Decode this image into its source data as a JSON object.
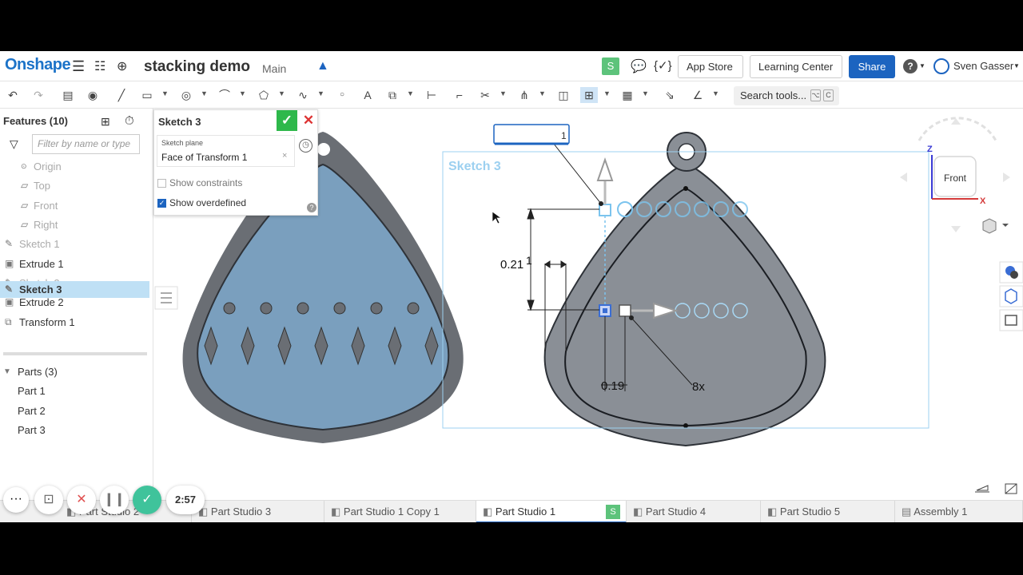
{
  "header": {
    "logo": "Onshape",
    "doc_title": "stacking demo",
    "branch": "Main",
    "badge": "S",
    "code_icon_text": "{✓}",
    "app_store": "App Store",
    "learning_center": "Learning Center",
    "share": "Share",
    "help": "?",
    "user": "Sven Gasser"
  },
  "toolbar": {
    "search_tools": "Search tools...",
    "kbd1": "⌥",
    "kbd2": "C"
  },
  "features": {
    "title": "Features (10)",
    "filter_placeholder": "Filter by name or type",
    "items": [
      {
        "label": "Origin",
        "icon": "origin-icon"
      },
      {
        "label": "Top",
        "icon": "plane-icon"
      },
      {
        "label": "Front",
        "icon": "plane-icon"
      },
      {
        "label": "Right",
        "icon": "plane-icon"
      },
      {
        "label": "Sketch 1",
        "icon": "sketch-icon"
      },
      {
        "label": "Extrude 1",
        "icon": "extrude-icon"
      },
      {
        "label": "Sketch 2",
        "icon": "sketch-icon"
      },
      {
        "label": "Extrude 2",
        "icon": "extrude-icon"
      },
      {
        "label": "Transform 1",
        "icon": "transform-icon"
      },
      {
        "label": "Sketch 3",
        "icon": "sketch-icon"
      }
    ],
    "parts_title": "Parts (3)",
    "parts": [
      "Part 1",
      "Part 2",
      "Part 3"
    ]
  },
  "sketch_dialog": {
    "title": "Sketch 3",
    "plane_label": "Sketch plane",
    "plane_value": "Face of Transform 1",
    "show_constraints": "Show constraints",
    "show_overdefined": "Show overdefined",
    "show_constraints_checked": false,
    "show_overdefined_checked": true
  },
  "viewport": {
    "sketch_label": "Sketch 3",
    "dim_input": "1",
    "dim_021": "0.21",
    "dim_1": "1",
    "dim_019": "0.19",
    "pattern_count": "8x",
    "view_cube_label": "Front",
    "axis_z": "Z",
    "axis_x": "X"
  },
  "recorder": {
    "time": "2:57"
  },
  "tabs": [
    {
      "label": "Part Studio 2",
      "active": false
    },
    {
      "label": "Part Studio 3",
      "active": false
    },
    {
      "label": "Part Studio 1 Copy 1",
      "active": false
    },
    {
      "label": "Part Studio 1",
      "active": true,
      "badge": "S"
    },
    {
      "label": "Part Studio 4",
      "active": false
    },
    {
      "label": "Part Studio 5",
      "active": false
    },
    {
      "label": "Assembly 1",
      "active": false
    }
  ],
  "colors": {
    "accent": "#1c64c0",
    "selection": "#bfe0f5",
    "part_blue": "#7a9fbe",
    "part_grey": "#8a8f96",
    "confirm_green": "#2eb84b",
    "cancel_red": "#d33"
  }
}
